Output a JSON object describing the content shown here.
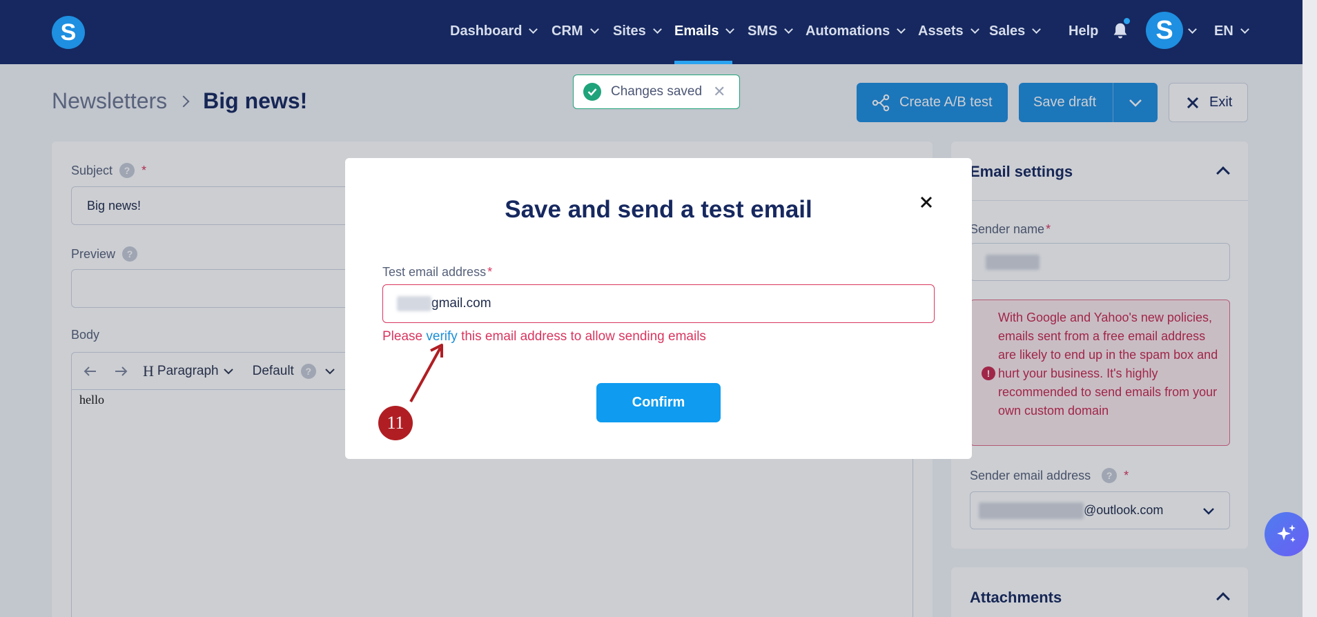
{
  "nav": {
    "items": [
      {
        "label": "Dashboard"
      },
      {
        "label": "CRM"
      },
      {
        "label": "Sites"
      },
      {
        "label": "Emails"
      },
      {
        "label": "SMS"
      },
      {
        "label": "Automations"
      },
      {
        "label": "Assets"
      },
      {
        "label": "Sales"
      }
    ],
    "active": "Emails",
    "help_label": "Help",
    "avatar_initial": "S",
    "language": "EN",
    "logo_letter": "S"
  },
  "breadcrumb": {
    "parent": "Newsletters",
    "current": "Big news!"
  },
  "toast": {
    "text": "Changes saved"
  },
  "actions": {
    "ab_test_label": "Create A/B test",
    "save_draft_label": "Save draft",
    "exit_label": "Exit"
  },
  "editor": {
    "subject_label": "Subject",
    "subject_value": "Big news!",
    "preview_label": "Preview",
    "preview_value": "",
    "body_label": "Body",
    "toolbar": {
      "block_style": "Paragraph",
      "font": "Default"
    },
    "body_text": "hello"
  },
  "settings": {
    "title": "Email settings",
    "sender_name_label": "Sender name",
    "warning_text": "With Google and Yahoo's new policies, emails sent from a free email address are likely to end up in the spam box and hurt your business. It's highly recommended to send emails from your own custom domain",
    "sender_email_label": "Sender email address",
    "sender_email_domain": "@outlook.com",
    "attachments_title": "Attachments"
  },
  "modal": {
    "title": "Save and send a test email",
    "field_label": "Test email address",
    "required_mark": "*",
    "input_value_visible": "gmail.com",
    "error_prefix": "Please",
    "error_link": "verify",
    "error_suffix": "this email address to allow sending emails",
    "confirm_label": "Confirm"
  },
  "annotation": {
    "step_number": "11"
  },
  "colors": {
    "nav_bg": "#16285f",
    "primary": "#1e8fe1",
    "error": "#d9365f",
    "success": "#1fa37a",
    "badge": "#b01e23"
  }
}
